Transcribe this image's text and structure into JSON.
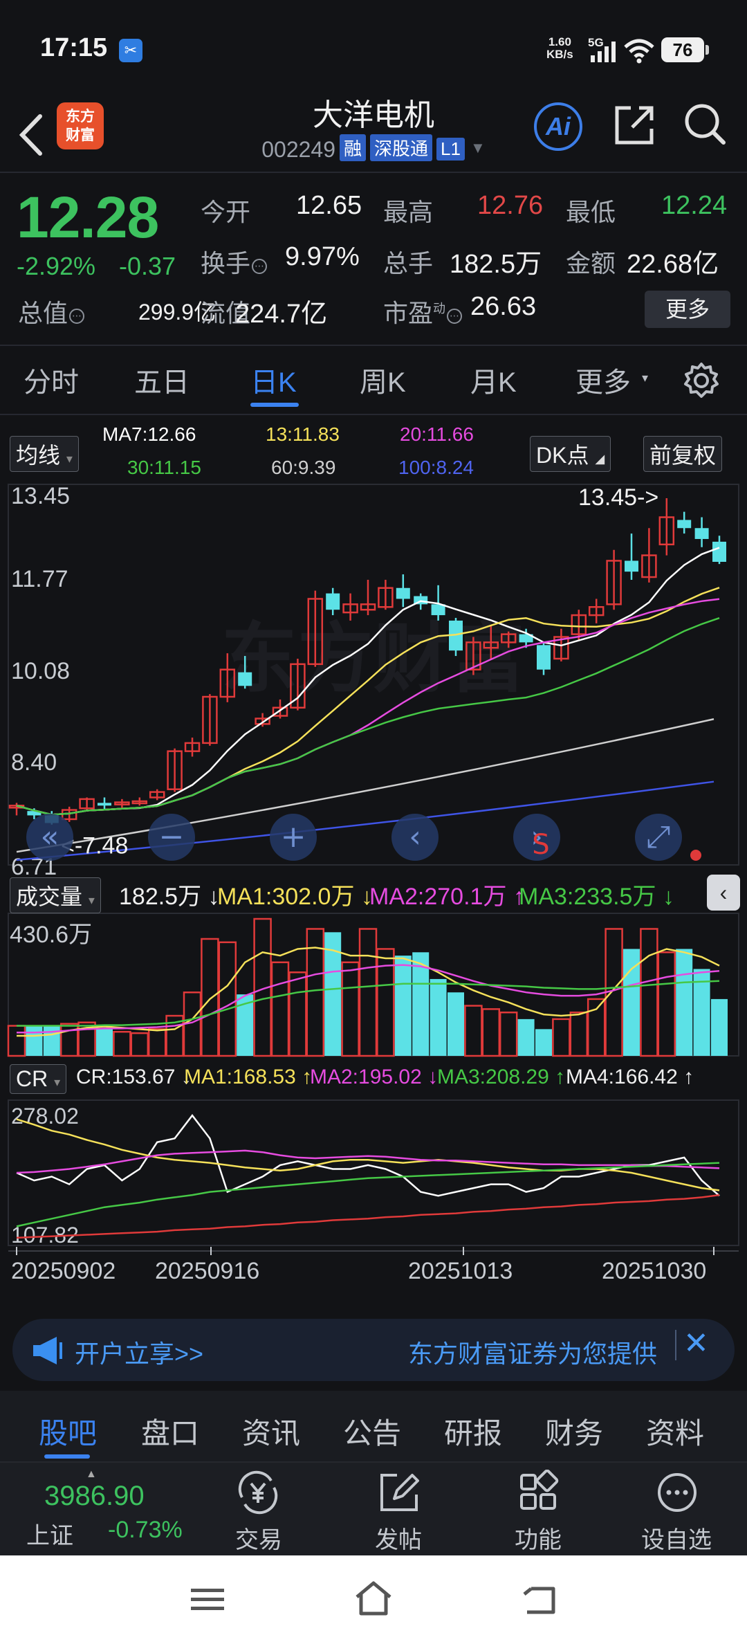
{
  "status_bar": {
    "time": "17:15",
    "net_speed_top": "1.60",
    "net_speed_unit": "KB/s",
    "network": "5G",
    "battery": "76"
  },
  "header": {
    "logo_line1": "东方",
    "logo_line2": "财富",
    "stock_name": "大洋电机",
    "stock_code": "002249",
    "tags": [
      "融",
      "深股通",
      "L1"
    ],
    "ai_label": "Ai"
  },
  "quote": {
    "price": "12.28",
    "change_pct": "-2.92%",
    "change_abs": "-0.37",
    "stats": [
      {
        "label": "今开",
        "value": "12.65",
        "color": "#f0f0f0"
      },
      {
        "label": "最高",
        "value": "12.76",
        "color": "#e24848"
      },
      {
        "label": "最低",
        "value": "12.24",
        "color": "#3dc25f"
      },
      {
        "label": "换手",
        "value": "9.97%",
        "color": "#f0f0f0"
      },
      {
        "label": "总手",
        "value": "182.5万",
        "color": "#f0f0f0"
      },
      {
        "label": "金额",
        "value": "22.68亿",
        "color": "#f0f0f0"
      },
      {
        "label": "总值",
        "value": "299.9亿",
        "color": "#f0f0f0"
      },
      {
        "label": "流值",
        "value": "224.7亿",
        "color": "#f0f0f0"
      },
      {
        "label": "市盈",
        "value": "26.63",
        "color": "#f0f0f0"
      }
    ],
    "pe_superscript": "动",
    "more_label": "更多"
  },
  "chart_tabs": [
    "分时",
    "五日",
    "日K",
    "周K",
    "月K",
    "更多"
  ],
  "active_chart_tab": "日K",
  "kline": {
    "ma_selector": "均线",
    "ma_values": [
      {
        "text": "MA7:12.66",
        "color": "#ffffff"
      },
      {
        "text": "13:11.83",
        "color": "#f5e15a"
      },
      {
        "text": "20:11.66",
        "color": "#e64ce0"
      },
      {
        "text": "30:11.15",
        "color": "#46c846"
      },
      {
        "text": "60:9.39",
        "color": "#cfcfcf"
      },
      {
        "text": "100:8.24",
        "color": "#3f54e6"
      }
    ],
    "dk_label": "DK点",
    "adjust_label": "前复权",
    "y_labels": [
      "13.45",
      "11.77",
      "10.08",
      "8.40",
      "6.71"
    ],
    "high_marker": "13.45->",
    "low_marker": "<-7.48"
  },
  "volume": {
    "selector": "成交量",
    "value": "182.5万",
    "ma1": "MA1:302.0万",
    "ma2": "MA2:270.1万",
    "ma3": "MA3:233.5万",
    "max_label": "430.6万"
  },
  "cr": {
    "selector": "CR",
    "value": "CR:153.67",
    "ma1": "MA1:168.53",
    "ma2": "MA2:195.02",
    "ma3": "MA3:208.29",
    "ma4": "MA4:166.42",
    "y_top": "278.02",
    "y_bottom": "107.82"
  },
  "x_dates": [
    "20250902",
    "20250916",
    "20251013",
    "20251030"
  ],
  "banner": {
    "left": "开户立享>>",
    "right": "东方财富证券为您提供"
  },
  "bottom_tabs": [
    "股吧",
    "盘口",
    "资讯",
    "公告",
    "研报",
    "财务",
    "资料"
  ],
  "active_bottom_tab": "股吧",
  "index": {
    "value": "3986.90",
    "name": "上证",
    "change": "-0.73%"
  },
  "nav_items": [
    {
      "label": "交易",
      "icon": "yen-cycle-icon"
    },
    {
      "label": "发帖",
      "icon": "edit-icon"
    },
    {
      "label": "功能",
      "icon": "grid-icon"
    },
    {
      "label": "设自选",
      "icon": "more-dots-icon"
    }
  ]
}
